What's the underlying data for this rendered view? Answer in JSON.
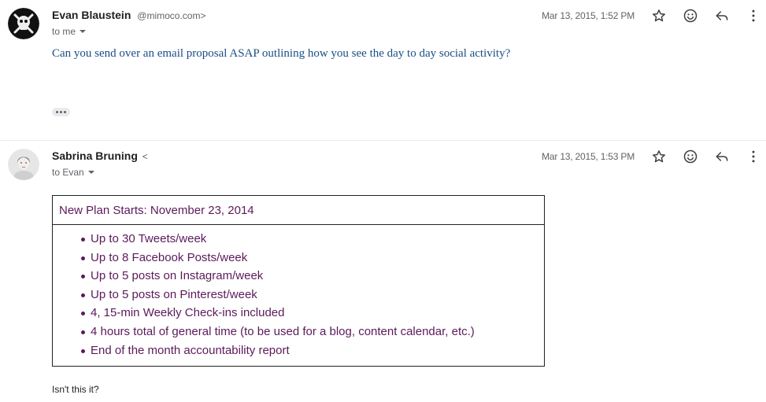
{
  "messages": [
    {
      "sender_name": "Evan Blaustein",
      "sender_email": "@mimoco.com>",
      "recipient_line": "to me",
      "date": "Mar 13, 2015, 1:52 PM",
      "body": "Can you send over an email proposal ASAP outlining how you see the day to day social activity?"
    },
    {
      "sender_name": "Sabrina Bruning",
      "sender_email_partial": "<",
      "recipient_line": "to Evan",
      "date": "Mar 13, 2015, 1:53 PM",
      "plan_title": "New Plan Starts: November 23, 2014",
      "plan_items": [
        "Up to 30 Tweets/week",
        "Up to 8 Facebook Posts/week",
        "Up to 5 posts on Instagram/week",
        "Up to 5 posts on Pinterest/week",
        "4, 15-min Weekly Check-ins included",
        "4 hours total of general time (to be used for a blog, content calendar, etc.)",
        "End of the month accountability report"
      ],
      "closing": "Isn't this it?"
    }
  ],
  "icons": {
    "star": "star-icon",
    "emoji": "emoji-reaction-icon",
    "reply": "reply-icon",
    "more": "more-vert-icon",
    "dropdown": "chevron-down-icon",
    "expand": "more-horiz-icon"
  },
  "colors": {
    "body_text_blue": "#1a4d86",
    "plan_text_purple": "#5b1a5b",
    "icon_gray": "#5f6368"
  }
}
